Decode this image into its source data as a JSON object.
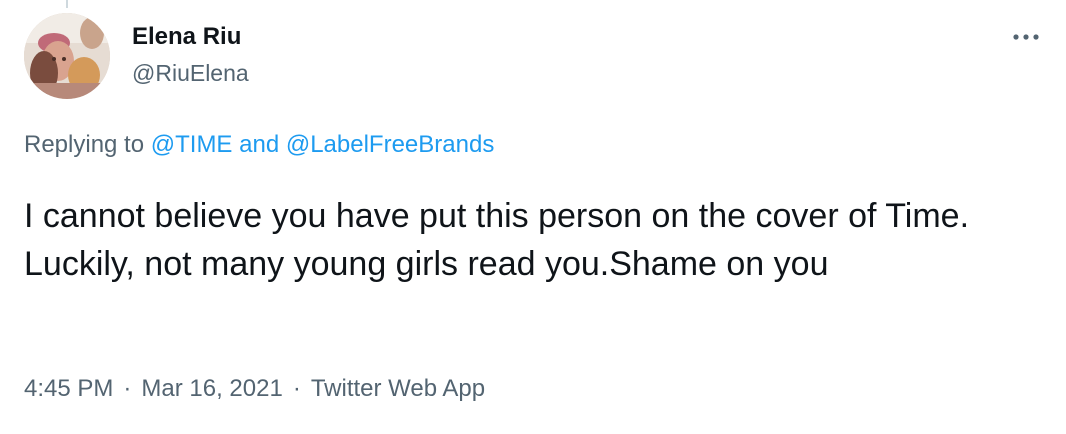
{
  "author": {
    "name": "Elena Riu",
    "handle": "@RiuElena"
  },
  "more_icon": "more-horizontal-icon",
  "reply": {
    "prefix": "Replying to",
    "mentions": [
      "@TIME",
      "@LabelFreeBrands"
    ],
    "conjunction": "and"
  },
  "tweet": {
    "text": "I cannot believe you have put this person on the cover of Time. Luckily, not many young girls read you.Shame on you"
  },
  "meta": {
    "time": "4:45 PM",
    "separator": "·",
    "date": "Mar 16, 2021",
    "source": "Twitter Web App"
  },
  "colors": {
    "text": "#0f1419",
    "secondary": "#536471",
    "link": "#1d9bf0"
  }
}
